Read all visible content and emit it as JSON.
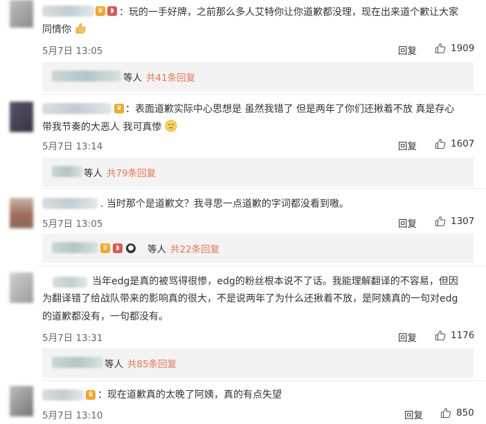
{
  "comments": [
    {
      "text_line1": "：玩的一手好牌，之前那么多人艾特你让你道歉都没理，现在出来道个歉让大家",
      "text_line2": "同情你",
      "date": "5月7日 13:05",
      "reply_label": "回复",
      "likes": "1909",
      "thread": {
        "people": "等人",
        "count": "共41条回复"
      }
    },
    {
      "text_line1": "：表面道歉实际中心思想是 虽然我错了 但是两年了你们还揪着不放 真是存心",
      "text_line2": "带我节奏的大恶人 我可真惨",
      "date": "5月7日 13:14",
      "reply_label": "回复",
      "likes": "1607",
      "thread": {
        "people": "等人",
        "count": "共79条回复"
      }
    },
    {
      "text_line1": ". 当时那个是道歉文？我寻思一点道歉的字词都没看到嗷。",
      "date": "5月7日 13:05",
      "reply_label": "回复",
      "likes": "1307",
      "thread": {
        "people": "等人",
        "count": "共22条回复"
      }
    },
    {
      "text_line1": "当年edg是真的被骂得很惨，edg的粉丝根本说不了话。我能理解翻译的不容易，但因",
      "text_line2": "为翻译错了给战队带来的影响真的很大，不是说两年了为什么还揪着不放，是阿姨真的一句对edg",
      "text_line3": "的道歉都没有，一句都没有。",
      "date": "5月7日 13:31",
      "reply_label": "回复",
      "likes": "1176",
      "thread": {
        "people": "等人",
        "count": "共85条回复"
      }
    },
    {
      "text_line1": "：现在道歉真的太晚了阿姨，真的有点失望",
      "date": "5月7日 13:10",
      "reply_label": "回复",
      "likes": "850"
    }
  ],
  "icons": {
    "like": "thumbs-up-icon",
    "badge_vip": "vip-crown-icon",
    "badge_fruit": "watermelon-icon",
    "badge_panda": "panda-icon",
    "emoji_thumb": "thumbs-up-emoji",
    "emoji_sad": "sad-face-emoji"
  },
  "colors": {
    "count_accent": "#eb7350",
    "reply_bg": "#f3f3f3"
  }
}
